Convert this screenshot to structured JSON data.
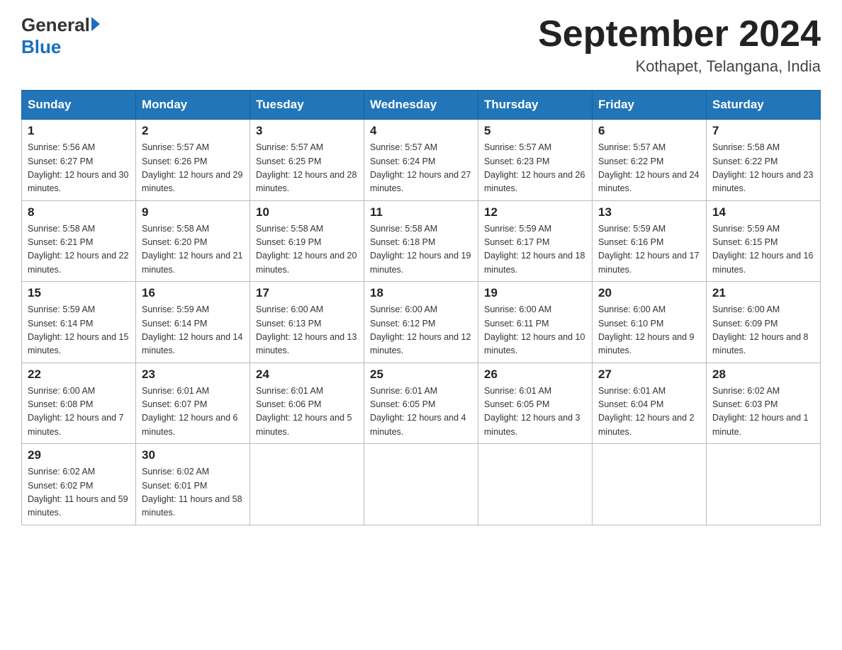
{
  "logo": {
    "general": "General",
    "blue": "Blue"
  },
  "title": "September 2024",
  "subtitle": "Kothapet, Telangana, India",
  "weekdays": [
    "Sunday",
    "Monday",
    "Tuesday",
    "Wednesday",
    "Thursday",
    "Friday",
    "Saturday"
  ],
  "weeks": [
    [
      {
        "day": "1",
        "sunrise": "Sunrise: 5:56 AM",
        "sunset": "Sunset: 6:27 PM",
        "daylight": "Daylight: 12 hours and 30 minutes."
      },
      {
        "day": "2",
        "sunrise": "Sunrise: 5:57 AM",
        "sunset": "Sunset: 6:26 PM",
        "daylight": "Daylight: 12 hours and 29 minutes."
      },
      {
        "day": "3",
        "sunrise": "Sunrise: 5:57 AM",
        "sunset": "Sunset: 6:25 PM",
        "daylight": "Daylight: 12 hours and 28 minutes."
      },
      {
        "day": "4",
        "sunrise": "Sunrise: 5:57 AM",
        "sunset": "Sunset: 6:24 PM",
        "daylight": "Daylight: 12 hours and 27 minutes."
      },
      {
        "day": "5",
        "sunrise": "Sunrise: 5:57 AM",
        "sunset": "Sunset: 6:23 PM",
        "daylight": "Daylight: 12 hours and 26 minutes."
      },
      {
        "day": "6",
        "sunrise": "Sunrise: 5:57 AM",
        "sunset": "Sunset: 6:22 PM",
        "daylight": "Daylight: 12 hours and 24 minutes."
      },
      {
        "day": "7",
        "sunrise": "Sunrise: 5:58 AM",
        "sunset": "Sunset: 6:22 PM",
        "daylight": "Daylight: 12 hours and 23 minutes."
      }
    ],
    [
      {
        "day": "8",
        "sunrise": "Sunrise: 5:58 AM",
        "sunset": "Sunset: 6:21 PM",
        "daylight": "Daylight: 12 hours and 22 minutes."
      },
      {
        "day": "9",
        "sunrise": "Sunrise: 5:58 AM",
        "sunset": "Sunset: 6:20 PM",
        "daylight": "Daylight: 12 hours and 21 minutes."
      },
      {
        "day": "10",
        "sunrise": "Sunrise: 5:58 AM",
        "sunset": "Sunset: 6:19 PM",
        "daylight": "Daylight: 12 hours and 20 minutes."
      },
      {
        "day": "11",
        "sunrise": "Sunrise: 5:58 AM",
        "sunset": "Sunset: 6:18 PM",
        "daylight": "Daylight: 12 hours and 19 minutes."
      },
      {
        "day": "12",
        "sunrise": "Sunrise: 5:59 AM",
        "sunset": "Sunset: 6:17 PM",
        "daylight": "Daylight: 12 hours and 18 minutes."
      },
      {
        "day": "13",
        "sunrise": "Sunrise: 5:59 AM",
        "sunset": "Sunset: 6:16 PM",
        "daylight": "Daylight: 12 hours and 17 minutes."
      },
      {
        "day": "14",
        "sunrise": "Sunrise: 5:59 AM",
        "sunset": "Sunset: 6:15 PM",
        "daylight": "Daylight: 12 hours and 16 minutes."
      }
    ],
    [
      {
        "day": "15",
        "sunrise": "Sunrise: 5:59 AM",
        "sunset": "Sunset: 6:14 PM",
        "daylight": "Daylight: 12 hours and 15 minutes."
      },
      {
        "day": "16",
        "sunrise": "Sunrise: 5:59 AM",
        "sunset": "Sunset: 6:14 PM",
        "daylight": "Daylight: 12 hours and 14 minutes."
      },
      {
        "day": "17",
        "sunrise": "Sunrise: 6:00 AM",
        "sunset": "Sunset: 6:13 PM",
        "daylight": "Daylight: 12 hours and 13 minutes."
      },
      {
        "day": "18",
        "sunrise": "Sunrise: 6:00 AM",
        "sunset": "Sunset: 6:12 PM",
        "daylight": "Daylight: 12 hours and 12 minutes."
      },
      {
        "day": "19",
        "sunrise": "Sunrise: 6:00 AM",
        "sunset": "Sunset: 6:11 PM",
        "daylight": "Daylight: 12 hours and 10 minutes."
      },
      {
        "day": "20",
        "sunrise": "Sunrise: 6:00 AM",
        "sunset": "Sunset: 6:10 PM",
        "daylight": "Daylight: 12 hours and 9 minutes."
      },
      {
        "day": "21",
        "sunrise": "Sunrise: 6:00 AM",
        "sunset": "Sunset: 6:09 PM",
        "daylight": "Daylight: 12 hours and 8 minutes."
      }
    ],
    [
      {
        "day": "22",
        "sunrise": "Sunrise: 6:00 AM",
        "sunset": "Sunset: 6:08 PM",
        "daylight": "Daylight: 12 hours and 7 minutes."
      },
      {
        "day": "23",
        "sunrise": "Sunrise: 6:01 AM",
        "sunset": "Sunset: 6:07 PM",
        "daylight": "Daylight: 12 hours and 6 minutes."
      },
      {
        "day": "24",
        "sunrise": "Sunrise: 6:01 AM",
        "sunset": "Sunset: 6:06 PM",
        "daylight": "Daylight: 12 hours and 5 minutes."
      },
      {
        "day": "25",
        "sunrise": "Sunrise: 6:01 AM",
        "sunset": "Sunset: 6:05 PM",
        "daylight": "Daylight: 12 hours and 4 minutes."
      },
      {
        "day": "26",
        "sunrise": "Sunrise: 6:01 AM",
        "sunset": "Sunset: 6:05 PM",
        "daylight": "Daylight: 12 hours and 3 minutes."
      },
      {
        "day": "27",
        "sunrise": "Sunrise: 6:01 AM",
        "sunset": "Sunset: 6:04 PM",
        "daylight": "Daylight: 12 hours and 2 minutes."
      },
      {
        "day": "28",
        "sunrise": "Sunrise: 6:02 AM",
        "sunset": "Sunset: 6:03 PM",
        "daylight": "Daylight: 12 hours and 1 minute."
      }
    ],
    [
      {
        "day": "29",
        "sunrise": "Sunrise: 6:02 AM",
        "sunset": "Sunset: 6:02 PM",
        "daylight": "Daylight: 11 hours and 59 minutes."
      },
      {
        "day": "30",
        "sunrise": "Sunrise: 6:02 AM",
        "sunset": "Sunset: 6:01 PM",
        "daylight": "Daylight: 11 hours and 58 minutes."
      },
      null,
      null,
      null,
      null,
      null
    ]
  ]
}
